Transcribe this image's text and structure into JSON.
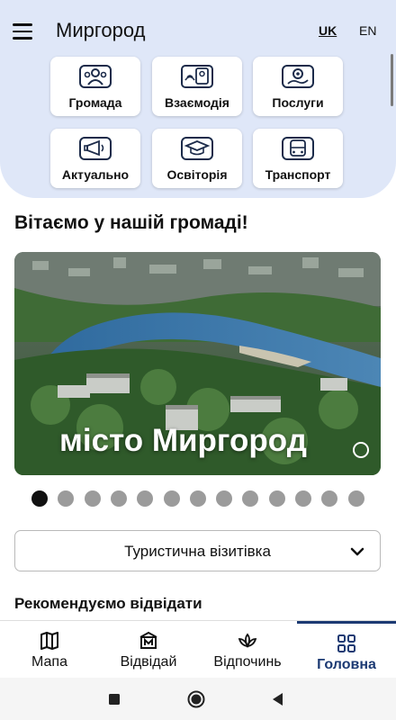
{
  "app": {
    "title": "Миргород"
  },
  "languages": [
    {
      "label": "UK",
      "active": true
    },
    {
      "label": "EN",
      "active": false
    }
  ],
  "tiles": [
    {
      "label": "Громада",
      "icon": "community-icon"
    },
    {
      "label": "Взаємодія",
      "icon": "interaction-icon"
    },
    {
      "label": "Послуги",
      "icon": "services-icon"
    },
    {
      "label": "Актуально",
      "icon": "megaphone-icon"
    },
    {
      "label": "Освіторія",
      "icon": "education-icon"
    },
    {
      "label": "Транспорт",
      "icon": "bus-icon"
    }
  ],
  "welcome": "Вітаємо у нашій громаді!",
  "hero": {
    "caption": "місто Миргород",
    "slide_count": 13,
    "active_slide": 1
  },
  "dropdown": {
    "selected": "Туристична візитівка"
  },
  "section_title": "Рекомендуємо відвідати",
  "bottom_nav": [
    {
      "label": "Мапа",
      "icon": "map-icon",
      "active": false
    },
    {
      "label": "Відвідай",
      "icon": "museum-icon",
      "active": false
    },
    {
      "label": "Відпочинь",
      "icon": "lotus-icon",
      "active": false
    },
    {
      "label": "Головна",
      "icon": "grid-icon",
      "active": true
    }
  ],
  "colors": {
    "header_bg": "#dfe7f8",
    "accent": "#1c3a73"
  }
}
